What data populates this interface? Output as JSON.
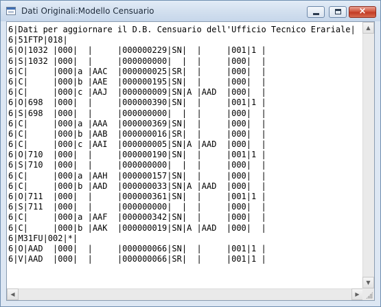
{
  "window": {
    "title": "Dati Originali:Modello Censuario",
    "icon": "document-icon",
    "controls": {
      "minimize": "minimize-icon",
      "maximize": "maximize-icon",
      "close": "×"
    }
  },
  "content": {
    "lines": [
      "6|Dati per aggiornare il D.B. Censuario dell'Ufficio Tecnico Erariale|",
      "6|51FTP|018|                                                             |",
      "6|O|1032 |000|  |     |000000229|SN|  |     |001|1 |                    |",
      "6|S|1032 |000|  |     |000000000|  |  |     |000|  |                    |",
      "6|C|     |000|a |AAC  |000000025|SR|  |     |000|  |                    |",
      "6|C|     |000|b |AAE  |000000195|SN|  |     |000|  |                    |",
      "6|C|     |000|c |AAJ  |000000009|SN|A |AAD  |000|  |                    |",
      "6|O|698  |000|  |     |000000390|SN|  |     |001|1 |                    |",
      "6|S|698  |000|  |     |000000000|  |  |     |000|  |                    |",
      "6|C|     |000|a |AAA  |000000369|SN|  |     |000|  |                    |",
      "6|C|     |000|b |AAB  |000000016|SR|  |     |000|  |                    |",
      "6|C|     |000|c |AAI  |000000005|SN|A |AAD  |000|  |                    |",
      "6|O|710  |000|  |     |000000190|SN|  |     |001|1 |                    |",
      "6|S|710  |000|  |     |000000000|  |  |     |000|  |                    |",
      "6|C|     |000|a |AAH  |000000157|SN|  |     |000|  |                    |",
      "6|C|     |000|b |AAD  |000000033|SN|A |AAD  |000|  |                    |",
      "6|O|711  |000|  |     |000000361|SN|  |     |001|1 |                    |",
      "6|S|711  |000|  |     |000000000|  |  |     |000|  |                    |",
      "6|C|     |000|a |AAF  |000000342|SN|  |     |000|  |                    |",
      "6|C|     |000|b |AAK  |000000019|SN|A |AAD  |000|  |                    |",
      "6|M31FU|002|*|                                                           |",
      "6|O|AAD  |000|  |     |000000066|SN|  |     |001|1 |                    |",
      "6|V|AAD  |000|  |     |000000066|SR|  |     |001|1 |                    |"
    ]
  },
  "scrollbars": {
    "vertical": {
      "up": "▲",
      "down": "▼"
    },
    "horizontal": {
      "left": "◀",
      "right": "▶"
    }
  }
}
